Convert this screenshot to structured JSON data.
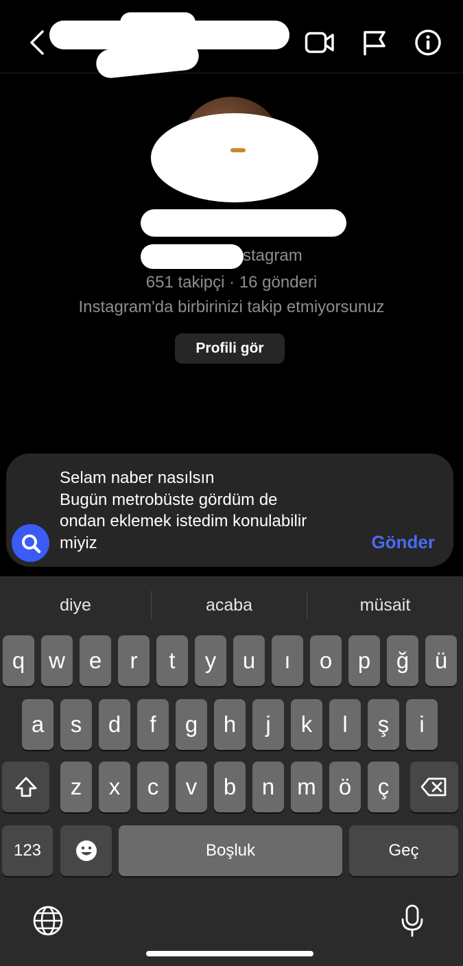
{
  "header": {
    "back_icon": "chevron-left-icon",
    "icons": [
      "video-camera-icon",
      "flag-icon",
      "info-icon"
    ]
  },
  "profile": {
    "source_suffix": "stagram",
    "stats": "651 takipçi · 16 gönderi",
    "mutual_text": "Instagram'da birbirinizi takip etmiyorsunuz",
    "view_profile_label": "Profili gör"
  },
  "composer": {
    "message_lines": [
      "Selam naber nasılsın",
      "Bugün metrobüste gördüm de",
      "ondan eklemek istedim konulabilir",
      "miyiz"
    ],
    "send_label": "Gönder",
    "search_icon": "search-icon"
  },
  "keyboard": {
    "suggestions": [
      "diye",
      "acaba",
      "müsait"
    ],
    "row1": [
      "q",
      "w",
      "e",
      "r",
      "t",
      "y",
      "u",
      "ı",
      "o",
      "p",
      "ğ",
      "ü"
    ],
    "row2": [
      "a",
      "s",
      "d",
      "f",
      "g",
      "h",
      "j",
      "k",
      "l",
      "ş",
      "i"
    ],
    "row3": [
      "z",
      "x",
      "c",
      "v",
      "b",
      "n",
      "m",
      "ö",
      "ç"
    ],
    "numbers_label": "123",
    "space_label": "Boşluk",
    "return_label": "Geç",
    "icons": [
      "shift-icon",
      "backspace-icon",
      "emoji-icon",
      "globe-icon",
      "microphone-icon"
    ]
  }
}
